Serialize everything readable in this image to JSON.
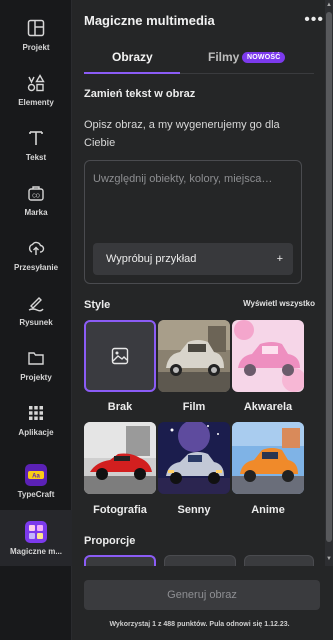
{
  "rail": {
    "items": [
      {
        "label": "Projekt",
        "icon": "layout-icon"
      },
      {
        "label": "Elementy",
        "icon": "shapes-icon"
      },
      {
        "label": "Tekst",
        "icon": "text-icon"
      },
      {
        "label": "Marka",
        "icon": "brand-kit-icon"
      },
      {
        "label": "Przesyłanie",
        "icon": "cloud-upload-icon"
      },
      {
        "label": "Rysunek",
        "icon": "pen-icon"
      },
      {
        "label": "Projekty",
        "icon": "folder-icon"
      },
      {
        "label": "Aplikacje",
        "icon": "apps-grid-icon"
      },
      {
        "label": "TypeCraft",
        "icon": "typecraft-app-icon"
      },
      {
        "label": "Magiczne m...",
        "icon": "magic-media-app-icon"
      }
    ]
  },
  "panel": {
    "title": "Magiczne multimedia",
    "more_icon": "more-dots-icon",
    "tabs": [
      {
        "label": "Obrazy",
        "active": true
      },
      {
        "label": "Filmy",
        "badge": "NOWOŚĆ"
      }
    ],
    "text_to_image": {
      "heading": "Zamień tekst w obraz",
      "description": "Opisz obraz, a my wygenerujemy go dla Ciebie",
      "placeholder": "Uwzględnij obiekty, kolory, miejsca…",
      "value": "",
      "try_example": "Wypróbuj przykład"
    },
    "styles": {
      "heading": "Style",
      "see_all": "Wyświetl wszystko",
      "items": [
        {
          "label": "Brak",
          "selected": true
        },
        {
          "label": "Film"
        },
        {
          "label": "Akwarela"
        },
        {
          "label": "Fotografia"
        },
        {
          "label": "Senny"
        },
        {
          "label": "Anime"
        }
      ]
    },
    "aspect": {
      "heading": "Proporcje"
    },
    "generate_label": "Generuj obraz",
    "credits_note": "Wykorzystaj 1 z 488 punktów. Pula odnowi się 1.12.23."
  },
  "colors": {
    "accent": "#8b5cf6",
    "badge": "#7c3aed",
    "panel_bg": "#252627",
    "rail_bg": "#18191b"
  }
}
